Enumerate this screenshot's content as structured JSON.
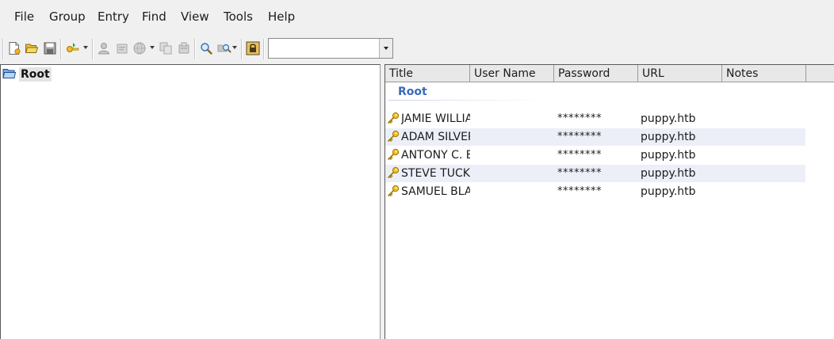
{
  "menu": {
    "items": [
      "File",
      "Group",
      "Entry",
      "Find",
      "View",
      "Tools",
      "Help"
    ]
  },
  "toolbar": {
    "buttons": [
      {
        "name": "new-database-icon"
      },
      {
        "name": "open-database-icon"
      },
      {
        "name": "save-database-icon"
      },
      {
        "name": "add-entry-icon"
      },
      {
        "name": "copy-username-icon"
      },
      {
        "name": "copy-password-icon"
      },
      {
        "name": "open-url-icon"
      },
      {
        "name": "copy-entry-icon"
      },
      {
        "name": "delete-entry-icon"
      },
      {
        "name": "find-icon"
      },
      {
        "name": "find-in-group-icon"
      },
      {
        "name": "lock-workspace-icon"
      }
    ],
    "quick_find_value": ""
  },
  "tree": {
    "root_label": "Root"
  },
  "list": {
    "columns": [
      "Title",
      "User Name",
      "Password",
      "URL",
      "Notes"
    ],
    "group_label": "Root",
    "rows": [
      {
        "title": "JAMIE WILLIA",
        "username": "",
        "password": "********",
        "url": "puppy.htb",
        "notes": ""
      },
      {
        "title": "ADAM SILVER",
        "username": "",
        "password": "********",
        "url": "puppy.htb",
        "notes": ""
      },
      {
        "title": "ANTONY C. E",
        "username": "",
        "password": "********",
        "url": "puppy.htb",
        "notes": ""
      },
      {
        "title": "STEVE TUCKE",
        "username": "",
        "password": "********",
        "url": "puppy.htb",
        "notes": ""
      },
      {
        "title": "SAMUEL BLAI",
        "username": "",
        "password": "********",
        "url": "puppy.htb",
        "notes": ""
      }
    ]
  },
  "colors": {
    "group_label": "#3a6ab8",
    "alt_row": "#eceff8",
    "key_gold": "#d8a010"
  }
}
